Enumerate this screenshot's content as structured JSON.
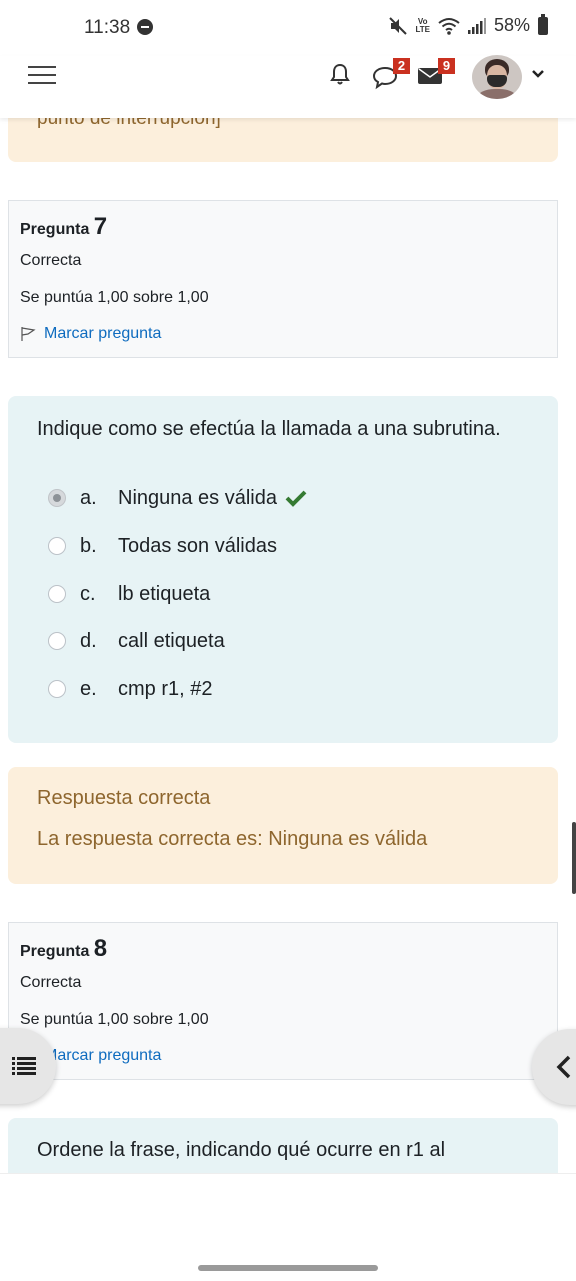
{
  "status_bar": {
    "time": "11:38",
    "battery": "58%",
    "volte_line1": "Vo",
    "volte_line2": "LTE",
    "icons": [
      "do-not-disturb-icon",
      "mute-icon",
      "volte-icon",
      "wifi-icon",
      "signal-icon",
      "battery-icon"
    ]
  },
  "navbar": {
    "icons": [
      "menu-icon",
      "bell-icon",
      "chat-icon",
      "mail-icon",
      "avatar",
      "chevron-down-icon"
    ],
    "messages_badge": "2",
    "mail_badge": "9"
  },
  "previous_feedback": {
    "text": "punto de interrupción]"
  },
  "question7": {
    "label": "Pregunta",
    "number": "7",
    "state": "Correcta",
    "grade": "Se puntúa 1,00 sobre 1,00",
    "flag_label": "Marcar pregunta",
    "text": "Indique como se efectúa la llamada a una subrutina.",
    "options": [
      {
        "letter": "a.",
        "text": "Ninguna es válida",
        "selected": true,
        "correct": true
      },
      {
        "letter": "b.",
        "text": "Todas son válidas",
        "selected": false
      },
      {
        "letter": "c.",
        "text": "lb etiqueta",
        "selected": false
      },
      {
        "letter": "d.",
        "text": "call etiqueta",
        "selected": false
      },
      {
        "letter": "e.",
        "text": "cmp r1, #2",
        "selected": false
      }
    ],
    "feedback_title": "Respuesta correcta",
    "feedback_answer": "La respuesta correcta es: Ninguna es válida"
  },
  "question8": {
    "label": "Pregunta",
    "number": "8",
    "state": "Correcta",
    "grade": "Se puntúa 1,00 sobre 1,00",
    "flag_label": "Marcar pregunta",
    "text": "Ordene la frase, indicando qué ocurre en r1 al"
  },
  "colors": {
    "accent": "#0f6cbf",
    "feedback_bg": "#fcefdc",
    "formulation_bg": "#e7f3f5",
    "correct_check": "#357a32",
    "badge": "#ca3120"
  }
}
